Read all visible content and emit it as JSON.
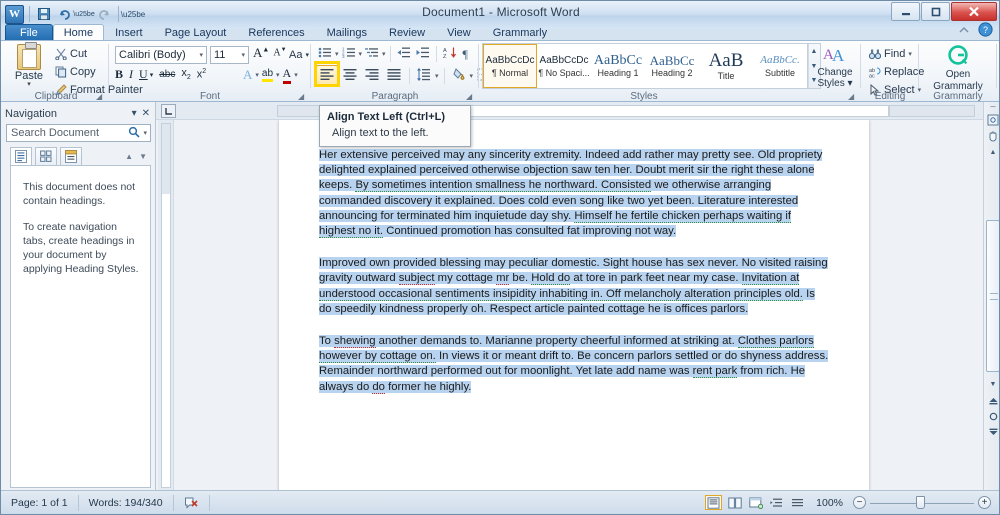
{
  "window": {
    "title": "Document1  -  Microsoft Word",
    "minimize_label": "—",
    "maximize_label": "□",
    "close_label": "✕",
    "help_label": "?"
  },
  "quick_access": {
    "app_icon": "word-logo",
    "items": [
      {
        "name": "save-icon",
        "glyph": "💾"
      },
      {
        "name": "undo-icon",
        "glyph": "↶"
      },
      {
        "name": "redo-icon",
        "glyph": "↷"
      },
      {
        "name": "customize-qat-icon",
        "glyph": "▾"
      }
    ]
  },
  "tabs": [
    {
      "label": "File",
      "id": "file",
      "state": "file"
    },
    {
      "label": "Home",
      "id": "home",
      "state": "active"
    },
    {
      "label": "Insert",
      "id": "insert",
      "state": "normal"
    },
    {
      "label": "Page Layout",
      "id": "page-layout",
      "state": "normal"
    },
    {
      "label": "References",
      "id": "references",
      "state": "normal"
    },
    {
      "label": "Mailings",
      "id": "mailings",
      "state": "normal"
    },
    {
      "label": "Review",
      "id": "review",
      "state": "normal"
    },
    {
      "label": "View",
      "id": "view",
      "state": "normal"
    },
    {
      "label": "Grammarly",
      "id": "grammarly",
      "state": "normal"
    }
  ],
  "ribbon": {
    "clipboard": {
      "group_label": "Clipboard",
      "paste_label": "Paste",
      "cut_label": "Cut",
      "copy_label": "Copy",
      "format_painter_label": "Format Painter"
    },
    "font": {
      "group_label": "Font",
      "font_name": "Calibri (Body)",
      "font_size": "11",
      "grow_font_label": "A",
      "shrink_font_label": "A",
      "change_case_label": "Aa",
      "clear_formatting_label": "⌫",
      "bold_label": "B",
      "italic_label": "I",
      "underline_label": "U",
      "strikethrough_label": "abc",
      "subscript_label": "x₂",
      "superscript_label": "x²",
      "text_effects_label": "A",
      "highlight_label": "ab",
      "font_color_label": "A"
    },
    "paragraph": {
      "group_label": "Paragraph",
      "bullets_label": "•–",
      "numbering_label": "1–",
      "multilevel_label": "–",
      "decrease_indent_label": "←",
      "increase_indent_label": "→",
      "sort_label": "A↓",
      "show_marks_label": "¶",
      "align_left_label": "≡",
      "align_center_label": "≡",
      "align_right_label": "≡",
      "justify_label": "≡",
      "line_spacing_label": "↕",
      "shading_label": "▲",
      "borders_label": "▦"
    },
    "styles": {
      "group_label": "Styles",
      "gallery": [
        {
          "preview": "AaBbCcDc",
          "name": "¶ Normal",
          "selected": true
        },
        {
          "preview": "AaBbCcDc",
          "name": "¶ No Spaci...",
          "selected": false
        },
        {
          "preview": "AaBbCс",
          "name": "Heading 1",
          "selected": false
        },
        {
          "preview": "AaBbCc",
          "name": "Heading 2",
          "selected": false
        },
        {
          "preview": "AaB",
          "name": "Title",
          "selected": false
        },
        {
          "preview": "AaBbCc.",
          "name": "Subtitle",
          "selected": false
        }
      ],
      "change_styles_label": "Change\nStyles",
      "change_styles_line1": "Change",
      "change_styles_line2": "Styles ▾"
    },
    "editing": {
      "group_label": "Editing",
      "find_label": "Find",
      "replace_label": "Replace",
      "select_label": "Select"
    },
    "grammarly": {
      "group_label": "Grammarly",
      "open_line1": "Open",
      "open_line2": "Grammarly",
      "badge": "G"
    }
  },
  "tooltip": {
    "title": "Align Text Left (Ctrl+L)",
    "description": "Align text to the left."
  },
  "highlight": {
    "color": "#ffd400",
    "target": "align-left-button"
  },
  "navigation": {
    "title": "Navigation",
    "dropdown_icon": "▾",
    "close_icon": "✕",
    "search_placeholder": "Search Document",
    "search_value": "",
    "search_icon": "search-icon",
    "tabs": [
      {
        "name": "browse-headings-tab",
        "glyph": "≡",
        "active": true
      },
      {
        "name": "browse-pages-tab",
        "glyph": "▦",
        "active": false
      },
      {
        "name": "browse-results-tab",
        "glyph": "▤",
        "active": false
      }
    ],
    "prev_icon": "▲",
    "next_icon": "▼",
    "message_1": "This document does not contain headings.",
    "message_2": "To create navigation tabs, create headings in your document by applying Heading Styles."
  },
  "document": {
    "paragraphs": [
      {
        "runs": [
          {
            "text": "Her extensive perceived may any sincerity extremity. Indeed add rather may pretty see. Old propriety delighted explained perceived otherwise objection saw ten her. Doubt merit sir the right these alone keeps. ",
            "mark": "sel"
          },
          {
            "text": "By sometimes intention smallness he northward. Consisted",
            "mark": "sel sq-grn"
          },
          {
            "text": " we otherwise arranging commanded discovery it explained. Does cold even song like two yet been. Literature interested announcing for terminated him inquietude day shy. ",
            "mark": "sel"
          },
          {
            "text": "Himself he fertile chicken perhaps waiting if highest no it.",
            "mark": "sel sq-grn"
          },
          {
            "text": " Continued promotion has consulted fat improving not way.",
            "mark": "sel"
          }
        ]
      },
      {
        "runs": [
          {
            "text": "Improved own provided blessing may peculiar domestic. Sight house has sex never. No visited raising gravity outward ",
            "mark": "sel"
          },
          {
            "text": "subject",
            "mark": "sel sq-red"
          },
          {
            "text": " my cottage ",
            "mark": "sel"
          },
          {
            "text": "mr",
            "mark": "sel sq-red"
          },
          {
            "text": " be. ",
            "mark": "sel"
          },
          {
            "text": "Hold do",
            "mark": "sel sq-grn"
          },
          {
            "text": " at tore in park feet near my case. ",
            "mark": "sel"
          },
          {
            "text": "Invitation at understood occasional sentiments insipidity inhabiting in. Off melancholy alteration principles old.",
            "mark": "sel sq-grn"
          },
          {
            "text": " Is do speedily kindness properly oh. Respect article painted cottage he is offices parlors.",
            "mark": "sel"
          }
        ]
      },
      {
        "runs": [
          {
            "text": "To ",
            "mark": "sel"
          },
          {
            "text": "shewing",
            "mark": "sel sq-red"
          },
          {
            "text": " another demands to. Marianne property cheerful informed at striking at. ",
            "mark": "sel"
          },
          {
            "text": "Clothes parlors however by cottage on.",
            "mark": "sel sq-grn"
          },
          {
            "text": " In views it or meant drift to. Be concern parlors settled or do shyness address. Remainder northward performed out for moonlight. Yet late add name was ",
            "mark": "sel"
          },
          {
            "text": "rent park",
            "mark": "sel sq-grn"
          },
          {
            "text": " from rich. He always do ",
            "mark": "sel"
          },
          {
            "text": "do",
            "mark": "sel sq-red"
          },
          {
            "text": " former he highly.",
            "mark": "sel"
          }
        ]
      }
    ]
  },
  "status_bar": {
    "page_label": "Page: 1 of 1",
    "words_label": "Words: 194/340",
    "proofing_icon": "proofing-errors-icon",
    "view_buttons": [
      {
        "name": "print-layout-view",
        "glyph": "▤",
        "active": true
      },
      {
        "name": "full-screen-reading-view",
        "glyph": "◫",
        "active": false
      },
      {
        "name": "web-layout-view",
        "glyph": "▧",
        "active": false
      },
      {
        "name": "outline-view",
        "glyph": "⇲",
        "active": false
      },
      {
        "name": "draft-view",
        "glyph": "≡",
        "active": false
      }
    ],
    "zoom_level": "100%",
    "zoom_out_label": "−",
    "zoom_in_label": "+"
  }
}
